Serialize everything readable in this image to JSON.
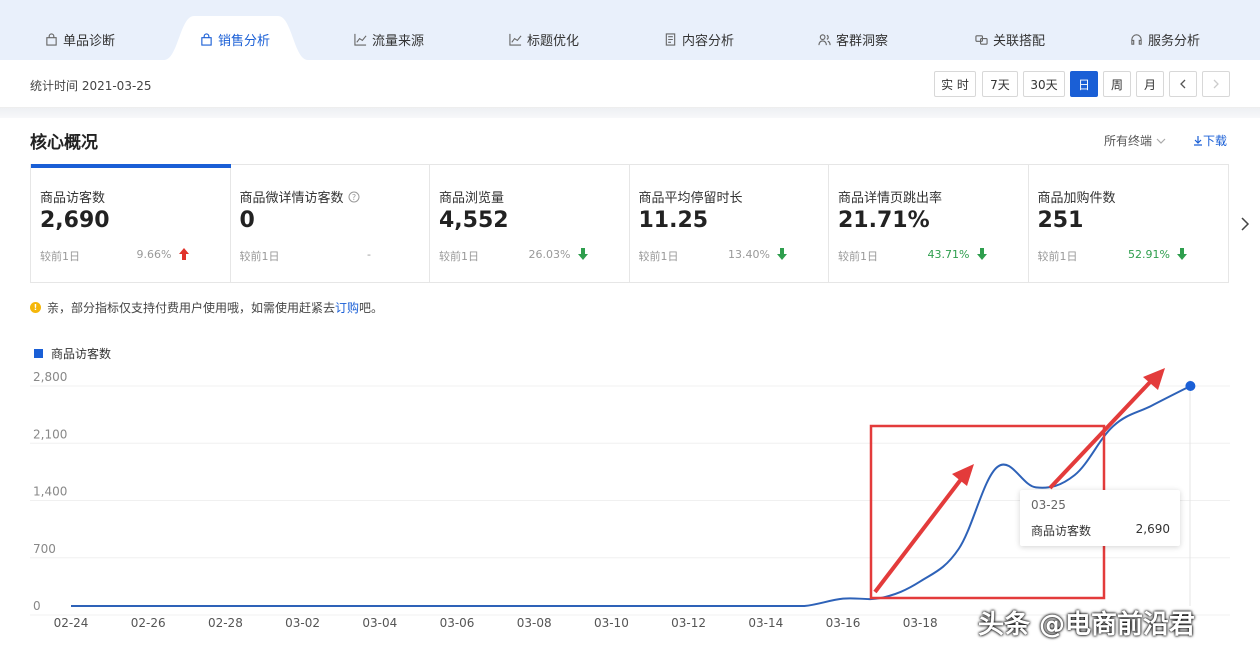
{
  "tabs": [
    {
      "label": "单品诊断",
      "icon": "bag-icon",
      "active": false
    },
    {
      "label": "销售分析",
      "icon": "bag-icon",
      "active": true
    },
    {
      "label": "流量来源",
      "icon": "trend-icon",
      "active": false
    },
    {
      "label": "标题优化",
      "icon": "trend-icon",
      "active": false
    },
    {
      "label": "内容分析",
      "icon": "document-icon",
      "active": false
    },
    {
      "label": "客群洞察",
      "icon": "people-icon",
      "active": false
    },
    {
      "label": "关联搭配",
      "icon": "link-icon",
      "active": false
    },
    {
      "label": "服务分析",
      "icon": "headset-icon",
      "active": false
    }
  ],
  "time": {
    "stat_label": "统计时间 2021-03-25",
    "ranges": [
      "实 时",
      "7天",
      "30天",
      "日",
      "周",
      "月"
    ],
    "active_range": "日"
  },
  "core": {
    "title": "核心概况",
    "terminal": "所有终端",
    "download": "下载"
  },
  "cards": [
    {
      "label": "商品访客数",
      "value": "2,690",
      "compare": "较前1日",
      "pct": "9.66%",
      "trend": "up",
      "active": true,
      "help": false
    },
    {
      "label": "商品微详情访客数",
      "value": "0",
      "compare": "较前1日",
      "pct": "-",
      "trend": "none",
      "active": false,
      "help": true
    },
    {
      "label": "商品浏览量",
      "value": "4,552",
      "compare": "较前1日",
      "pct": "26.03%",
      "trend": "down",
      "active": false,
      "help": false
    },
    {
      "label": "商品平均停留时长",
      "value": "11.25",
      "compare": "较前1日",
      "pct": "13.40%",
      "trend": "down",
      "active": false,
      "help": false
    },
    {
      "label": "商品详情页跳出率",
      "value": "21.71%",
      "compare": "较前1日",
      "pct": "43.71%",
      "trend": "down",
      "active": false,
      "help": false
    },
    {
      "label": "商品加购件数",
      "value": "251",
      "compare": "较前1日",
      "pct": "52.91%",
      "trend": "down",
      "active": false,
      "help": false
    }
  ],
  "notice": {
    "text": "亲，部分指标仅支持付费用户使用哦，如需使用赶紧去",
    "link": "订购",
    "suffix": "吧。"
  },
  "colors": {
    "accent": "#1a5fd6",
    "up": "#e0332b",
    "down": "#2e9e4d",
    "annotation": "#e33b3b"
  },
  "chart_data": {
    "type": "line",
    "x": [
      "02-24",
      "02-25",
      "02-26",
      "02-27",
      "02-28",
      "03-01",
      "03-02",
      "03-03",
      "03-04",
      "03-05",
      "03-06",
      "03-07",
      "03-08",
      "03-09",
      "03-10",
      "03-11",
      "03-12",
      "03-13",
      "03-14",
      "03-15",
      "03-16",
      "03-17",
      "03-18",
      "03-19",
      "03-20",
      "03-21",
      "03-22",
      "03-23",
      "03-24",
      "03-25"
    ],
    "xticks": [
      "02-24",
      "02-26",
      "02-28",
      "03-02",
      "03-04",
      "03-06",
      "03-08",
      "03-10",
      "03-12",
      "03-14",
      "03-16",
      "03-18"
    ],
    "yticks": [
      "2,800",
      "2,100",
      "1,400",
      "700",
      "0"
    ],
    "ylim": [
      0,
      2800
    ],
    "series": [
      {
        "name": "商品访客数",
        "values": [
          0,
          0,
          0,
          0,
          0,
          0,
          0,
          0,
          0,
          0,
          0,
          0,
          0,
          0,
          0,
          0,
          0,
          0,
          0,
          0,
          90,
          100,
          300,
          700,
          1700,
          1450,
          1600,
          2200,
          2450,
          2690
        ]
      }
    ],
    "legend": "top-left",
    "grid": true,
    "tooltip": {
      "date": "03-25",
      "name": "商品访客数",
      "value": "2,690"
    }
  },
  "watermark": "头条 @电商前沿君"
}
